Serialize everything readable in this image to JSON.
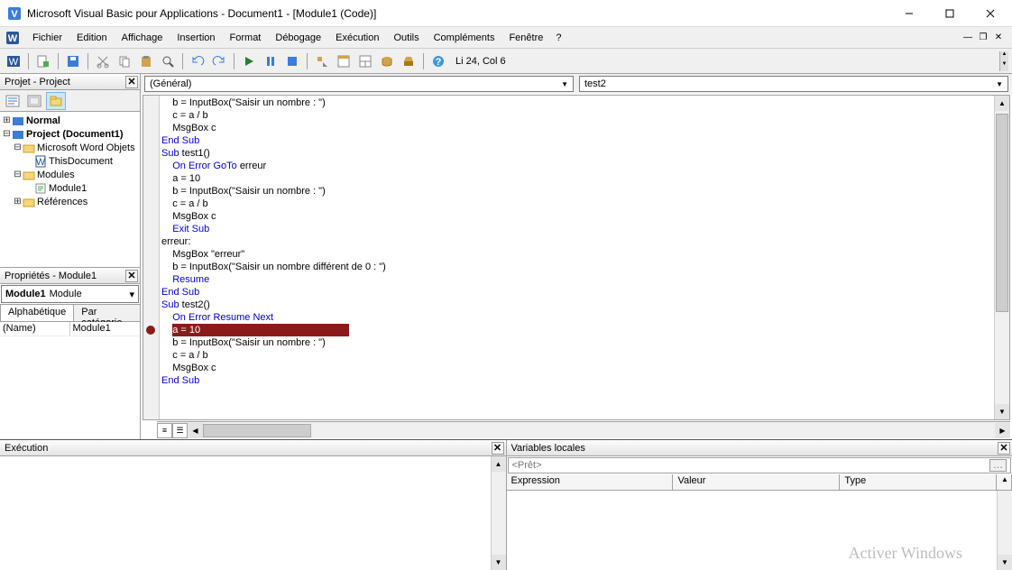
{
  "window": {
    "title": "Microsoft Visual Basic pour Applications - Document1 - [Module1 (Code)]"
  },
  "menu": {
    "items": [
      "Fichier",
      "Edition",
      "Affichage",
      "Insertion",
      "Format",
      "Débogage",
      "Exécution",
      "Outils",
      "Compléments",
      "Fenêtre"
    ],
    "help": "?"
  },
  "toolbar": {
    "status": "Li 24, Col 6"
  },
  "project_panel": {
    "title": "Projet - Project",
    "tree": {
      "normal": "Normal",
      "project": "Project (Document1)",
      "word_objects": "Microsoft Word Objets",
      "this_document": "ThisDocument",
      "modules": "Modules",
      "module1": "Module1",
      "references": "Références"
    }
  },
  "properties_panel": {
    "title": "Propriétés - Module1",
    "object_name": "Module1",
    "object_type": "Module",
    "tab_alpha": "Alphabétique",
    "tab_cat": "Par catégorie",
    "prop_name_key": "(Name)",
    "prop_name_val": "Module1"
  },
  "code_header": {
    "left_combo": "(Général)",
    "right_combo": "test2"
  },
  "code_lines": [
    {
      "indent": 4,
      "segs": [
        {
          "t": "b = InputBox(\"Saisir un nombre : \")"
        }
      ]
    },
    {
      "indent": 4,
      "segs": [
        {
          "t": "c = a / b"
        }
      ]
    },
    {
      "indent": 4,
      "segs": [
        {
          "t": "MsgBox c"
        }
      ]
    },
    {
      "indent": 0,
      "segs": [
        {
          "t": "End Sub",
          "k": true
        }
      ]
    },
    {
      "indent": 0,
      "segs": [
        {
          "t": "Sub ",
          "k": true
        },
        {
          "t": "test1()"
        }
      ]
    },
    {
      "indent": 4,
      "segs": [
        {
          "t": "On Error GoTo ",
          "k": true
        },
        {
          "t": "erreur"
        }
      ]
    },
    {
      "indent": 4,
      "segs": [
        {
          "t": "a = 10"
        }
      ]
    },
    {
      "indent": 4,
      "segs": [
        {
          "t": "b = InputBox(\"Saisir un nombre : \")"
        }
      ]
    },
    {
      "indent": 4,
      "segs": [
        {
          "t": "c = a / b"
        }
      ]
    },
    {
      "indent": 4,
      "segs": [
        {
          "t": "MsgBox c"
        }
      ]
    },
    {
      "indent": 4,
      "segs": [
        {
          "t": "Exit Sub",
          "k": true
        }
      ]
    },
    {
      "indent": 0,
      "segs": [
        {
          "t": "erreur:"
        }
      ]
    },
    {
      "indent": 4,
      "segs": [
        {
          "t": "MsgBox \"erreur\""
        }
      ]
    },
    {
      "indent": 4,
      "segs": [
        {
          "t": "b = InputBox(\"Saisir un nombre différent de 0 : \")"
        }
      ]
    },
    {
      "indent": 4,
      "segs": [
        {
          "t": "Resume",
          "k": true
        }
      ]
    },
    {
      "indent": 0,
      "segs": [
        {
          "t": "End Sub",
          "k": true
        }
      ]
    },
    {
      "indent": 0,
      "segs": [
        {
          "t": "Sub ",
          "k": true
        },
        {
          "t": "test2()"
        }
      ]
    },
    {
      "indent": 4,
      "segs": [
        {
          "t": "On Error Resume Next",
          "k": true
        }
      ]
    },
    {
      "indent": 4,
      "hl": true,
      "segs": [
        {
          "t": "a = 10"
        }
      ]
    },
    {
      "indent": 4,
      "segs": [
        {
          "t": "b = InputBox(\"Saisir un nombre : \")"
        }
      ]
    },
    {
      "indent": 4,
      "segs": [
        {
          "t": "c = a / b"
        }
      ]
    },
    {
      "indent": 4,
      "segs": [
        {
          "t": "MsgBox c"
        }
      ]
    },
    {
      "indent": 0,
      "segs": [
        {
          "t": "End Sub",
          "k": true
        }
      ]
    }
  ],
  "breakpoint_line_index": 18,
  "exec_panel": {
    "title": "Exécution"
  },
  "locals_panel": {
    "title": "Variables locales",
    "context": "<Prêt>",
    "col_expr": "Expression",
    "col_val": "Valeur",
    "col_type": "Type"
  },
  "watermark": "Activer Windows"
}
